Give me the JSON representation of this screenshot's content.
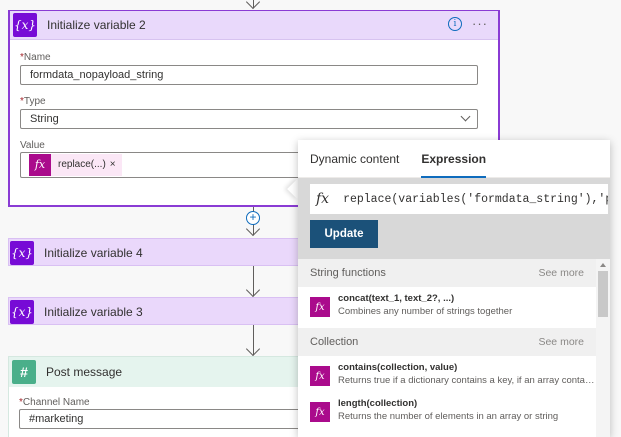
{
  "cards": {
    "iv2": {
      "title": "Initialize variable 2",
      "name_label": "Name",
      "name_value": "formdata_nopayload_string",
      "type_label": "Type",
      "type_value": "String",
      "value_label": "Value",
      "value_token": "replace(...)",
      "token_remove": "×"
    },
    "iv4": {
      "title": "Initialize variable 4"
    },
    "iv3": {
      "title": "Initialize variable 3"
    },
    "post": {
      "title": "Post message",
      "channel_label": "Channel Name",
      "channel_value": "#marketing"
    }
  },
  "icons": {
    "variable": "{x}",
    "fx": "fx",
    "slack": "#",
    "info": "i",
    "more": "···",
    "plus": "+"
  },
  "panel": {
    "tabs": [
      "Dynamic content",
      "Expression"
    ],
    "active_tab": "Expression",
    "expression": "replace(variables('formdata_string'),'payl",
    "update_label": "Update",
    "sections": [
      {
        "title": "String functions",
        "see_more": "See more",
        "functions": [
          {
            "name": "concat(text_1, text_2?, ...)",
            "desc": "Combines any number of strings together"
          }
        ]
      },
      {
        "title": "Collection",
        "see_more": "See more",
        "functions": [
          {
            "name": "contains(collection, value)",
            "desc": "Returns true if a dictionary contains a key, if an array contains a value, or if a string contains a substring"
          },
          {
            "name": "length(collection)",
            "desc": "Returns the number of elements in an array or string"
          }
        ]
      }
    ]
  },
  "colors": {
    "variable_accent": "#770bd6",
    "expression_accent": "#aa0b8c",
    "update_button": "#1b5179",
    "slack_accent": "#4aaf8a"
  }
}
